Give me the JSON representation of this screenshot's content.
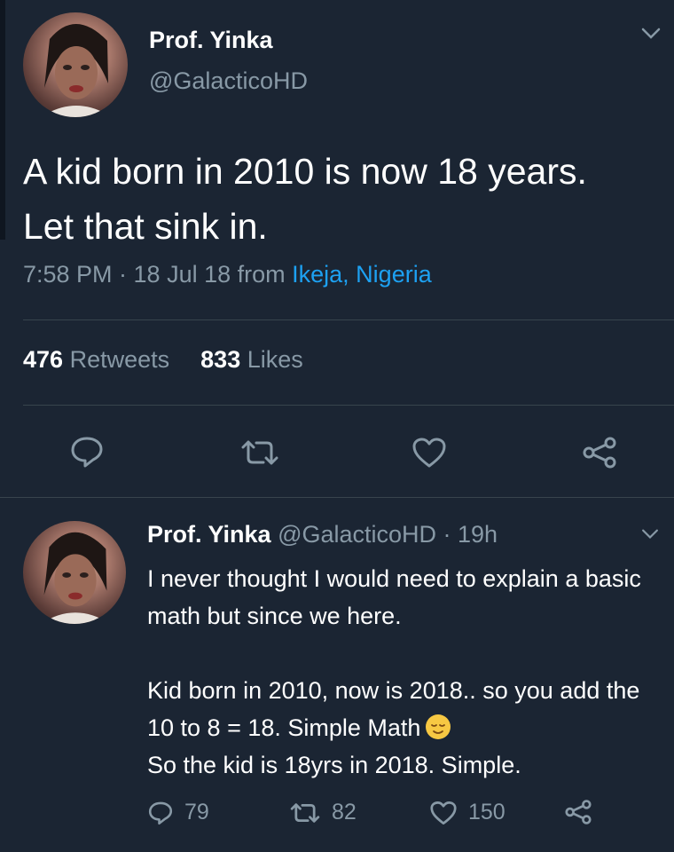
{
  "tweet": {
    "author_name": "Prof. Yinka",
    "author_handle": "@GalacticoHD",
    "text": "A kid born in 2010 is now 18 years. Let that sink in.",
    "time": "7:58 PM · 18 Jul 18 from ",
    "location": "Ikeja, Nigeria",
    "retweet_count": "476",
    "retweet_label": " Retweets",
    "like_count": "833",
    "like_label": " Likes"
  },
  "reply": {
    "author_name": "Prof. Yinka",
    "author_handle": " @GalacticoHD · 19h",
    "line1": "I never thought I would need to explain a basic math but since we here.",
    "line2": "Kid born in 2010, now is 2018.. so you add the 10 to 8 = 18. Simple Math",
    "line3": "So the kid is 18yrs in 2018. Simple.",
    "reply_count": "79",
    "retweet_count": "82",
    "like_count": "150"
  },
  "colors": {
    "background": "#1b2533",
    "muted": "#8899a6",
    "link": "#1da1f2",
    "divider": "#38444d"
  },
  "icons": {
    "reply": "reply-icon",
    "retweet": "retweet-icon",
    "like": "heart-icon",
    "share": "share-icon",
    "menu": "chevron-down-icon"
  }
}
